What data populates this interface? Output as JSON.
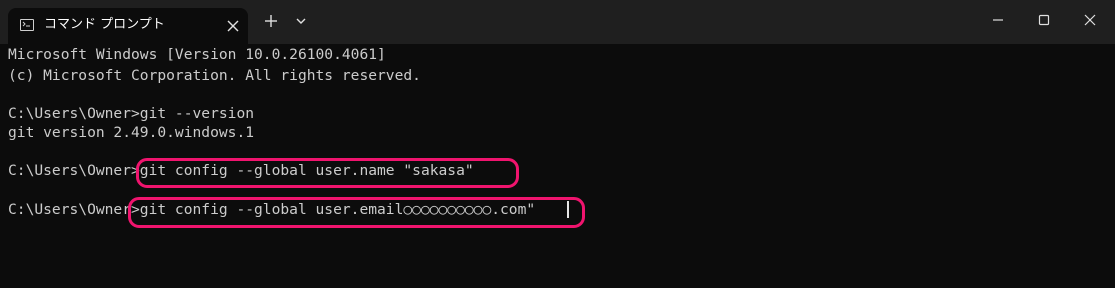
{
  "window": {
    "tab": {
      "title": "コマンド プロンプト",
      "icon": "cmd-icon"
    },
    "buttons": {
      "new_tab_icon": "plus-icon",
      "dropdown_icon": "chevron-down-icon",
      "minimize_icon": "minimize-icon",
      "maximize_icon": "maximize-icon",
      "close_icon": "close-icon"
    }
  },
  "terminal": {
    "lines": [
      "Microsoft Windows [Version 10.0.26100.4061]",
      "(c) Microsoft Corporation. All rights reserved.",
      "C:\\Users\\Owner>git --version",
      "git version 2.49.0.windows.1",
      "C:\\Users\\Owner>git config --global user.name \"sakasa\"",
      "C:\\Users\\Owner>git config --global user.email○○○○○○○○○○.com\""
    ]
  },
  "colors": {
    "titlebar": "#1f1f1f",
    "background": "#0c0c0c",
    "text": "#cccccc",
    "highlight": "#f0146e"
  }
}
